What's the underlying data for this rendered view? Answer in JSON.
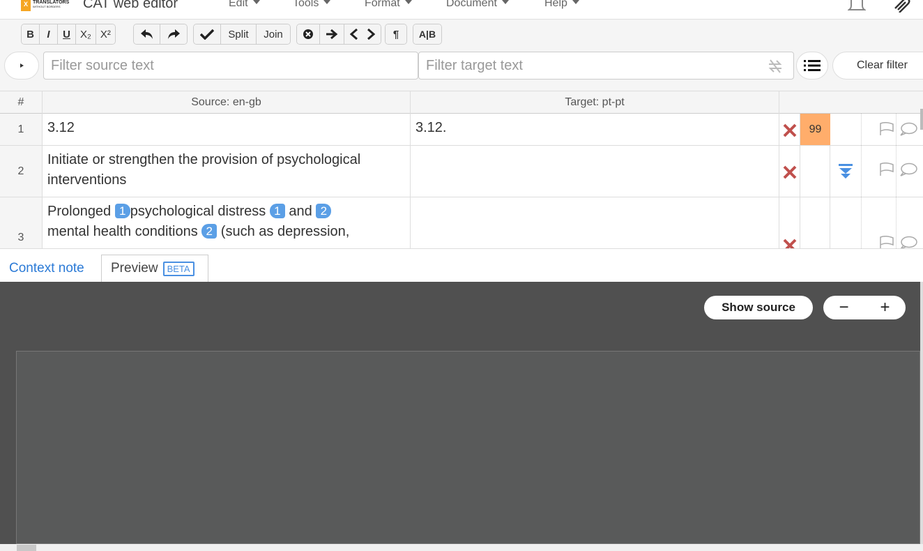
{
  "app": {
    "logo_text": "TRANSLATORS",
    "logo_subtext": "WITHOUT BORDERS",
    "title": "CAT web editor"
  },
  "menu": [
    "Edit",
    "Tools",
    "Format",
    "Document",
    "Help"
  ],
  "toolbar": {
    "bold": "B",
    "italic": "I",
    "underline": "U",
    "subscript": "X₂",
    "superscript": "X²",
    "split": "Split",
    "join": "Join",
    "pilcrow": "¶",
    "spellcheck": "A|B"
  },
  "filters": {
    "source_placeholder": "Filter source text",
    "target_placeholder": "Filter target text",
    "clear_label": "Clear filter"
  },
  "grid": {
    "headers": {
      "num": "#",
      "source": "Source: en-gb",
      "target": "Target: pt-pt"
    },
    "rows": [
      {
        "num": "1",
        "source": "3.12",
        "target": "3.12.",
        "score": "99"
      },
      {
        "num": "2",
        "source": "Initiate or strengthen the provision of psychological interventions",
        "target": ""
      },
      {
        "num": "3",
        "source_parts": [
          "Prolonged ",
          "1",
          "psychological distress ",
          "1",
          " and ",
          "2",
          "mental health conditions ",
          "2",
          " (such as depression,"
        ],
        "target": ""
      }
    ]
  },
  "tabs": {
    "context_note": "Context note",
    "preview": "Preview",
    "beta": "BETA"
  },
  "preview": {
    "show_source": "Show source",
    "zoom_out": "−",
    "zoom_in": "+"
  },
  "colors": {
    "accent": "#2b7ad6",
    "tag": "#5b9fe6",
    "score_bg": "#ffad6b",
    "error_x": "#c0504d",
    "preview_bg": "#505050"
  }
}
